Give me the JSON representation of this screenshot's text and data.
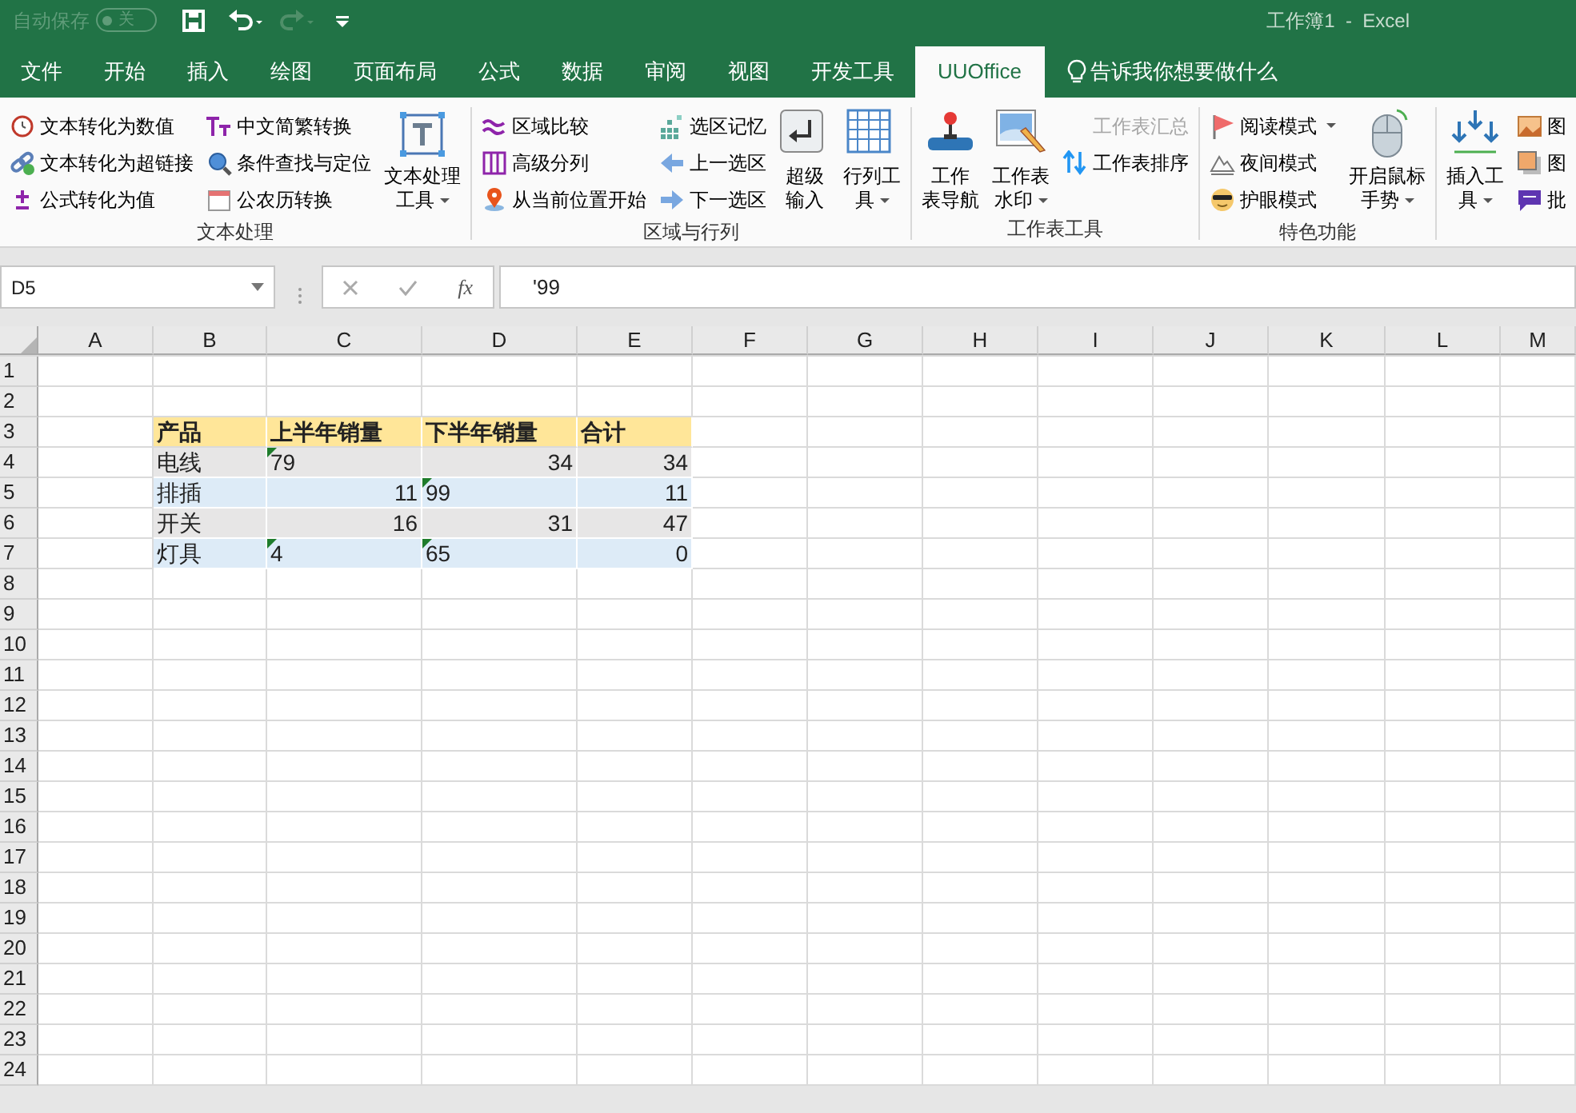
{
  "title_bar": {
    "autosave_label": "自动保存",
    "autosave_toggle": {
      "label": "关",
      "on": false
    },
    "title": "工作簿1  -  Excel"
  },
  "ribbon_tabs": [
    {
      "label": "文件",
      "selected": false
    },
    {
      "label": "开始",
      "selected": false
    },
    {
      "label": "插入",
      "selected": false
    },
    {
      "label": "绘图",
      "selected": false
    },
    {
      "label": "页面布局",
      "selected": false
    },
    {
      "label": "公式",
      "selected": false
    },
    {
      "label": "数据",
      "selected": false
    },
    {
      "label": "审阅",
      "selected": false
    },
    {
      "label": "视图",
      "selected": false
    },
    {
      "label": "开发工具",
      "selected": false
    },
    {
      "label": "UUOffice",
      "selected": true
    }
  ],
  "tell_me": "告诉我你想要做什么",
  "ribbon_groups": [
    {
      "label": "文本处理",
      "items": [
        {
          "kind": "small",
          "label": "文本转化为数值"
        },
        {
          "kind": "small",
          "label": "文本转化为超链接"
        },
        {
          "kind": "small",
          "label": "公式转化为值"
        },
        {
          "kind": "small",
          "label": "中文简繁转换"
        },
        {
          "kind": "small",
          "label": "条件查找与定位"
        },
        {
          "kind": "small",
          "label": "公农历转换"
        },
        {
          "kind": "large",
          "lines": [
            "文本处理",
            "工具"
          ],
          "dropdown": true
        }
      ]
    },
    {
      "label": "区域与行列",
      "items": [
        {
          "kind": "small",
          "label": "区域比较"
        },
        {
          "kind": "small",
          "label": "高级分列"
        },
        {
          "kind": "small",
          "label": "从当前位置开始"
        },
        {
          "kind": "small",
          "label": "选区记忆"
        },
        {
          "kind": "small",
          "label": "上一选区"
        },
        {
          "kind": "small",
          "label": "下一选区"
        },
        {
          "kind": "large",
          "lines": [
            "超级",
            "输入"
          ]
        },
        {
          "kind": "large",
          "lines": [
            "行列工",
            "具"
          ],
          "dropdown": true
        }
      ]
    },
    {
      "label": "工作表工具",
      "items": [
        {
          "kind": "large",
          "lines": [
            "工作",
            "表导航"
          ]
        },
        {
          "kind": "large",
          "lines": [
            "工作表",
            "水印"
          ],
          "dropdown": true
        },
        {
          "kind": "small",
          "label": "工作表汇总",
          "disabled": true
        },
        {
          "kind": "small",
          "label": "工作表排序",
          "disabled": false
        }
      ]
    },
    {
      "label": "特色功能",
      "items": [
        {
          "kind": "small",
          "label": "阅读模式",
          "dropdown": true
        },
        {
          "kind": "small",
          "label": "夜间模式"
        },
        {
          "kind": "small",
          "label": "护眼模式"
        },
        {
          "kind": "large",
          "lines": [
            "开启鼠标",
            "手势"
          ],
          "dropdown": true
        }
      ]
    },
    {
      "items": [
        {
          "kind": "large",
          "lines": [
            "插入工",
            "具"
          ],
          "dropdown": true
        },
        {
          "kind": "small",
          "label": "图"
        },
        {
          "kind": "small",
          "label": "图"
        },
        {
          "kind": "small",
          "label": "批"
        }
      ]
    }
  ],
  "formula_bar": {
    "name_box": "D5",
    "function_label": "fx",
    "formula": "'99"
  },
  "sheet": {
    "columns": [
      "A",
      "B",
      "C",
      "D",
      "E",
      "F",
      "G",
      "H",
      "I",
      "J",
      "K",
      "L",
      "M"
    ],
    "rows": [
      "1",
      "2",
      "3",
      "4",
      "5",
      "6",
      "7",
      "8",
      "9",
      "10",
      "11",
      "12",
      "13",
      "14",
      "15",
      "16",
      "17",
      "18",
      "19",
      "20",
      "21",
      "22",
      "23",
      "24"
    ],
    "table_rows": [
      {
        "kind": "header",
        "cells": [
          {
            "kind": "text",
            "text": "产品"
          },
          {
            "kind": "text",
            "text": "上半年销量"
          },
          {
            "kind": "text",
            "text": "下半年销量"
          },
          {
            "kind": "text",
            "text": "合计"
          }
        ]
      },
      {
        "kind": "data",
        "cells": [
          {
            "kind": "text",
            "text": "电线"
          },
          {
            "kind": "number",
            "text": "79",
            "stored_as_text": true
          },
          {
            "kind": "number",
            "text": "34",
            "stored_as_text": false
          },
          {
            "kind": "number",
            "text": "34",
            "stored_as_text": false
          }
        ]
      },
      {
        "kind": "data",
        "cells": [
          {
            "kind": "text",
            "text": "排插"
          },
          {
            "kind": "number",
            "text": "11",
            "stored_as_text": false
          },
          {
            "kind": "number",
            "text": "99",
            "stored_as_text": true
          },
          {
            "kind": "number",
            "text": "11",
            "stored_as_text": false
          }
        ]
      },
      {
        "kind": "data",
        "cells": [
          {
            "kind": "text",
            "text": "开关"
          },
          {
            "kind": "number",
            "text": "16",
            "stored_as_text": false
          },
          {
            "kind": "number",
            "text": "31",
            "stored_as_text": false
          },
          {
            "kind": "number",
            "text": "47",
            "stored_as_text": false
          }
        ]
      },
      {
        "kind": "data",
        "cells": [
          {
            "kind": "text",
            "text": "灯具"
          },
          {
            "kind": "number",
            "text": "4",
            "stored_as_text": true
          },
          {
            "kind": "number",
            "text": "65",
            "stored_as_text": true
          },
          {
            "kind": "number",
            "text": "0",
            "stored_as_text": false
          }
        ]
      }
    ]
  }
}
